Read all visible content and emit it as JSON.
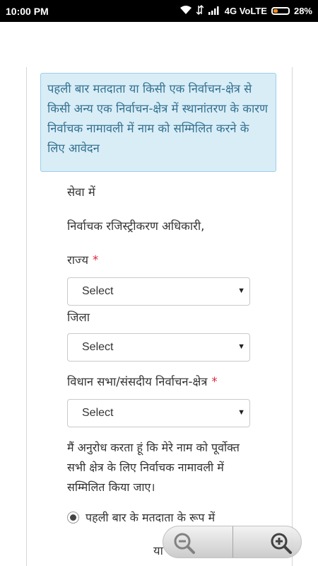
{
  "status_bar": {
    "time": "10:00 PM",
    "network": "4G VoLTE",
    "battery": "28%",
    "battery_level": 0.28
  },
  "notice": {
    "text": "पहली बार मतदाता या किसी एक निर्वाचन-क्षेत्र से किसी अन्य एक निर्वाचन-क्षेत्र में स्थानांतरण के कारण निर्वाचक नामावली में नाम को सम्मिलित करने के लिए आवेदन"
  },
  "form": {
    "salutation": "सेवा में",
    "officer": "निर्वाचक रजिस्ट्रीकरण अधिकारी,",
    "state": {
      "label": "राज्य",
      "required": "*",
      "value": "Select"
    },
    "district": {
      "label": "जिला",
      "value": "Select"
    },
    "constituency": {
      "label": "विधान सभा/संसदीय निर्वाचन-क्षेत्र",
      "required": "*",
      "value": "Select"
    },
    "request_text": "मैं अनुरोध करता हूं कि मेरे नाम को पूर्वोक्त सभी क्षेत्र के लिए निर्वाचक नामावली में सम्मिलित किया जाए।",
    "radio_first_time": "पहली बार के मतदाता के रूप में",
    "or_text": "या"
  },
  "icons": {
    "zoom_out": "zoom-out-icon",
    "zoom_in": "zoom-in-icon"
  }
}
